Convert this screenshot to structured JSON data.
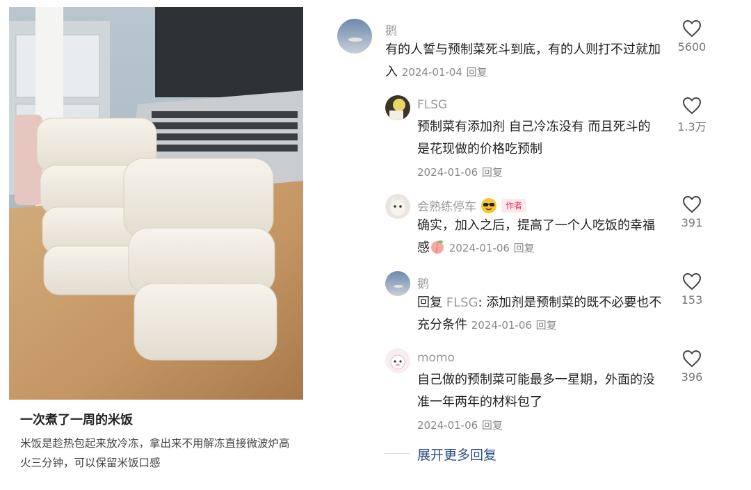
{
  "post": {
    "title": "一次煮了一周的米饭",
    "desc": "米饭是趁热包起来放冷冻，拿出来不用解冻直接微波炉高火三分钟，可以保留米饭口感"
  },
  "comments": [
    {
      "author": "鹅",
      "text": "有的人誓与预制菜死斗到底，有的人则打不过就加入",
      "date": "2024-01-04",
      "reply": "回复",
      "likes": "5600"
    },
    {
      "author": "FLSG",
      "text": "预制菜有添加剂 自己冷冻没有 而且死斗的是花现做的价格吃预制",
      "date": "2024-01-06",
      "reply": "回复",
      "likes": "1.3万"
    },
    {
      "author": "会熟练停车",
      "badge": "作者",
      "text": "确实，加入之后，提高了一个人吃饭的幸福感",
      "date": "2024-01-06",
      "reply": "回复",
      "likes": "391"
    },
    {
      "author": "鹅",
      "prefix": "回复 ",
      "mention": "FLSG",
      "text": ": 添加剂是预制菜的既不必要也不充分条件",
      "date": "2024-01-06",
      "reply": "回复",
      "likes": "153"
    },
    {
      "author": "momo",
      "text": "自己做的预制菜可能最多一星期，外面的没准一年两年的材料包了",
      "date": "2024-01-06",
      "reply": "回复",
      "likes": "396"
    }
  ],
  "expand_label": "展开更多回复",
  "icons": {
    "like": "heart-outline-icon"
  },
  "colors": {
    "author": "#9a9a9a",
    "link": "#2a4f86",
    "badge": "#e8375f"
  }
}
